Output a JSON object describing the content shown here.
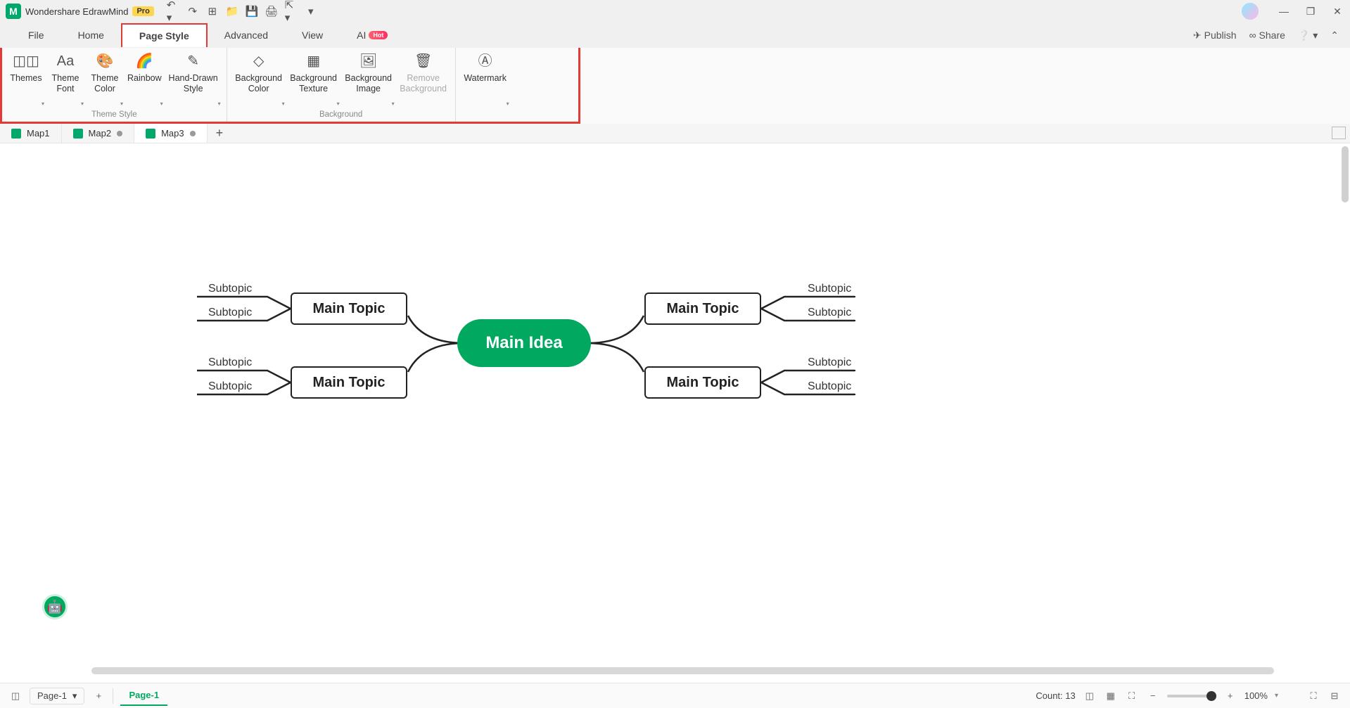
{
  "app": {
    "name": "Wondershare EdrawMind",
    "badge": "Pro"
  },
  "menus": [
    "File",
    "Home",
    "Page Style",
    "Advanced",
    "View",
    "AI"
  ],
  "active_menu": "Page Style",
  "ai_hot": "Hot",
  "menubar_actions": {
    "publish": "Publish",
    "share": "Share"
  },
  "ribbon": {
    "group1_label": "Theme Style",
    "group2_label": "Background",
    "themes": "Themes",
    "theme_font": "Theme\nFont",
    "theme_color": "Theme\nColor",
    "rainbow": "Rainbow",
    "hand_drawn": "Hand-Drawn\nStyle",
    "bg_color": "Background\nColor",
    "bg_texture": "Background\nTexture",
    "bg_image": "Background\nImage",
    "remove_bg": "Remove\nBackground",
    "watermark": "Watermark"
  },
  "doctabs": [
    "Map1",
    "Map2",
    "Map3"
  ],
  "active_doctab": "Map3",
  "mindmap": {
    "center": "Main Idea",
    "main_topic": "Main Topic",
    "subtopic": "Subtopic"
  },
  "status": {
    "page_select": "Page-1",
    "page_tab": "Page-1",
    "count_label": "Count: 13",
    "zoom": "100%"
  }
}
